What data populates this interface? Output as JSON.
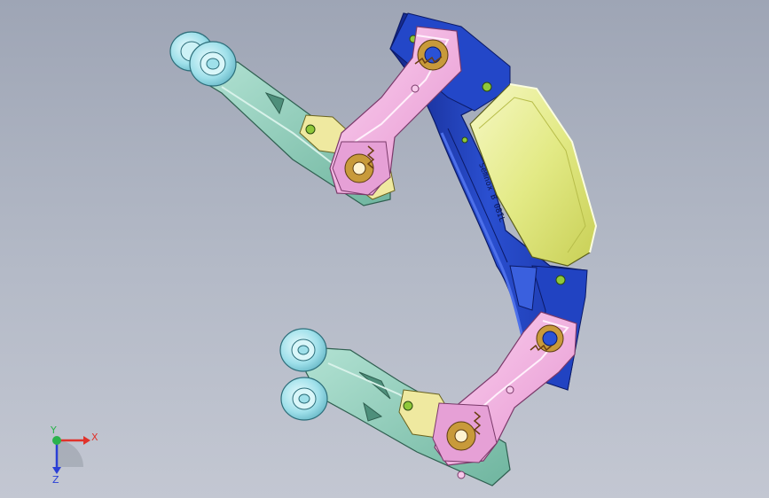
{
  "viewport": {
    "background_top": "#9ea5b5",
    "background_bottom": "#c3c7d2"
  },
  "model": {
    "colors": {
      "frame_blue": "#1f3fb8",
      "frame_blue_dark": "#13278a",
      "housing_yellow": "#e6ec8f",
      "link_pink": "#f2aee0",
      "arm_teal": "#88c9b6",
      "wheel_cyan": "#9fe0ea",
      "bracket_yellow": "#f0eaa0",
      "spring_bronze": "#b8862e"
    },
    "engraved_text": "Semnox B 08IL"
  },
  "triad": {
    "x_label": "X",
    "y_label": "Y",
    "z_label": "Z",
    "x_color": "#e0322b",
    "y_color": "#2bb24c",
    "z_color": "#2a3fd6"
  }
}
